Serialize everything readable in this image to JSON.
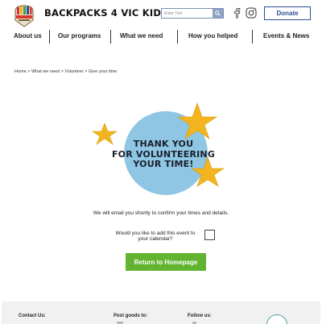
{
  "header": {
    "brand": "BACKPACKS 4 VIC KIDS",
    "search_placeholder": "Enter Text",
    "donate_label": "Donate",
    "colors": {
      "accent": "#2b4d9a",
      "search_button": "#8ea2c6"
    }
  },
  "nav": {
    "items": [
      {
        "label": "About us"
      },
      {
        "label": "Our programs"
      },
      {
        "label": "What we need"
      },
      {
        "label": "How you helped"
      },
      {
        "label": "Events & News"
      }
    ]
  },
  "breadcrumb": "Home > What we need > Volunteer > Give your time",
  "hero": {
    "line1": "THANK YOU",
    "line2": "FOR VOLUNTEERING",
    "line3": "YOUR TIME!",
    "colors": {
      "circle": "#8ec6e3",
      "star": "#f2b51f"
    }
  },
  "main": {
    "email_message": "We will email you shortly to confirm your times and details.",
    "calendar_prompt": "Would you like to add this event to your calendar?",
    "home_button": "Return to Homepage",
    "colors": {
      "button": "#62b32f"
    }
  },
  "footer": {
    "contact_heading": "Contact Us:",
    "post_heading": "Post goods to:",
    "follow_heading": "Follow us:"
  }
}
